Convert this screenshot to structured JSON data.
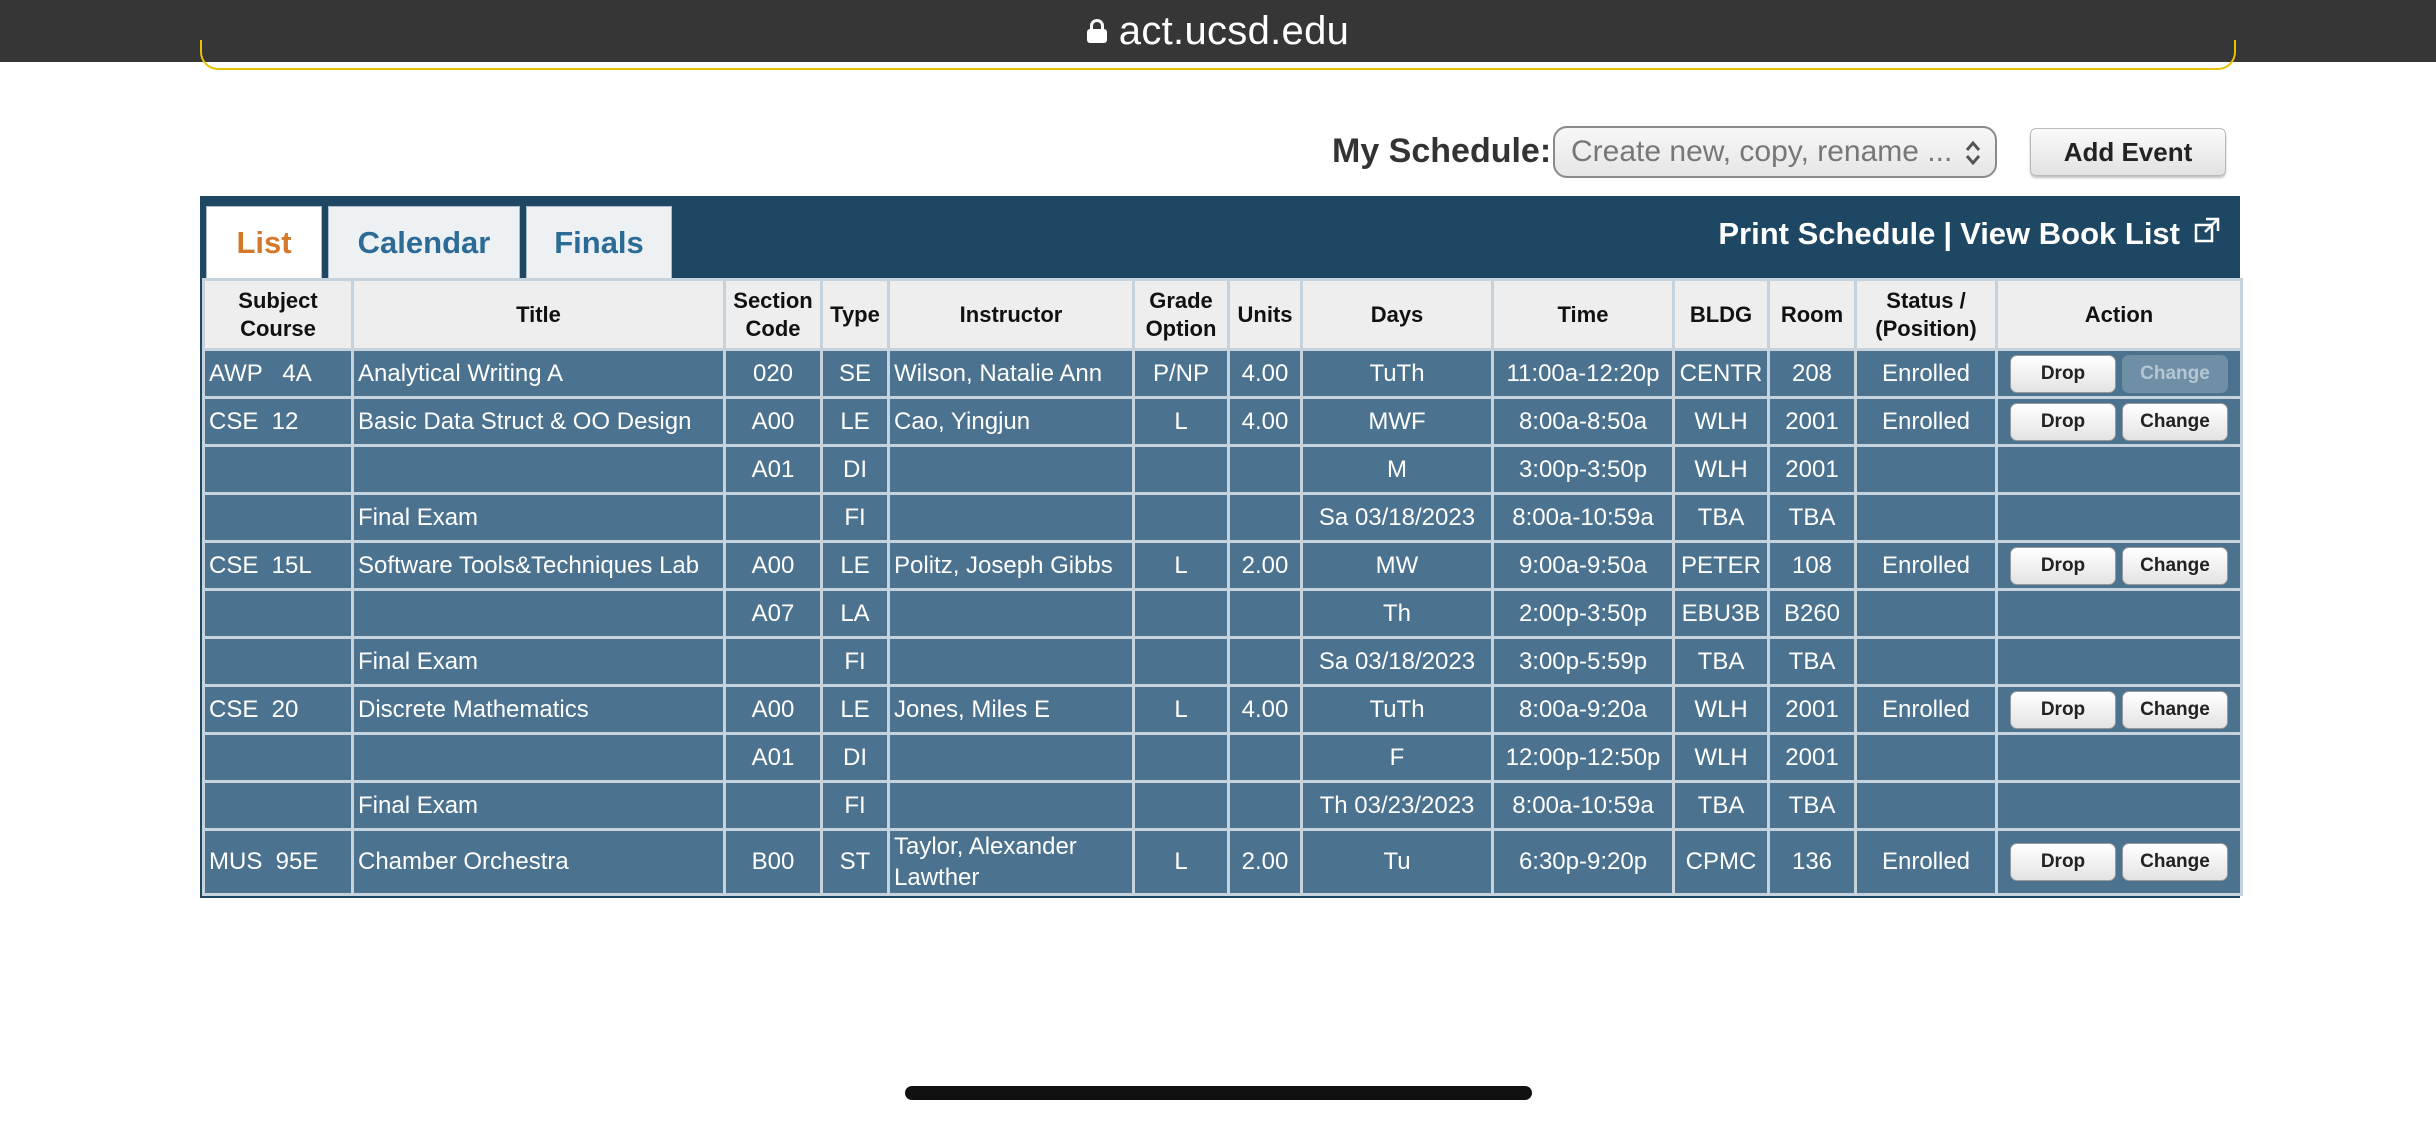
{
  "browser": {
    "url": "act.ucsd.edu"
  },
  "schedule": {
    "label": "My Schedule:",
    "select_placeholder": "Create new, copy, rename ...",
    "add_event_label": "Add Event"
  },
  "tabs": [
    {
      "label": "List",
      "active": true
    },
    {
      "label": "Calendar",
      "active": false
    },
    {
      "label": "Finals",
      "active": false
    }
  ],
  "links": {
    "print": "Print Schedule",
    "separator": "|",
    "booklist": "View Book List"
  },
  "table": {
    "headers": {
      "subject_line1": "Subject",
      "subject_line2": "Course",
      "title": "Title",
      "section_line1": "Section",
      "section_line2": "Code",
      "type": "Type",
      "instructor": "Instructor",
      "grade_line1": "Grade",
      "grade_line2": "Option",
      "units": "Units",
      "days": "Days",
      "time": "Time",
      "bldg": "BLDG",
      "room": "Room",
      "status_line1": "Status /",
      "status_line2": "(Position)",
      "action": "Action"
    },
    "rows": [
      {
        "subject": "AWP   4A",
        "title": "Analytical Writing A",
        "section": "020",
        "type": "SE",
        "instructor": "Wilson, Natalie Ann",
        "grade": "P/NP",
        "units": "4.00",
        "days": "TuTh",
        "time": "11:00a-12:20p",
        "bldg": "CENTR",
        "room": "208",
        "status": "Enrolled",
        "drop": "Drop",
        "change": "Change"
      },
      {
        "subject": "CSE  12",
        "title": "Basic Data Struct & OO Design",
        "section": "A00",
        "type": "LE",
        "instructor": "Cao, Yingjun",
        "grade": "L",
        "units": "4.00",
        "days": "MWF",
        "time": "8:00a-8:50a",
        "bldg": "WLH",
        "room": "2001",
        "status": "Enrolled",
        "drop": "Drop",
        "change": "Change"
      },
      {
        "subject": "",
        "title": "",
        "section": "A01",
        "type": "DI",
        "instructor": "",
        "grade": "",
        "units": "",
        "days": "M",
        "time": "3:00p-3:50p",
        "bldg": "WLH",
        "room": "2001",
        "status": ""
      },
      {
        "subject": "",
        "title": "Final Exam",
        "section": "",
        "type": "FI",
        "instructor": "",
        "grade": "",
        "units": "",
        "days": "Sa 03/18/2023",
        "time": "8:00a-10:59a",
        "bldg": "TBA",
        "room": "TBA",
        "status": ""
      },
      {
        "subject": "CSE  15L",
        "title": "Software Tools&Techniques Lab",
        "section": "A00",
        "type": "LE",
        "instructor": "Politz, Joseph Gibbs",
        "grade": "L",
        "units": "2.00",
        "days": "MW",
        "time": "9:00a-9:50a",
        "bldg": "PETER",
        "room": "108",
        "status": "Enrolled",
        "drop": "Drop",
        "change": "Change"
      },
      {
        "subject": "",
        "title": "",
        "section": "A07",
        "type": "LA",
        "instructor": "",
        "grade": "",
        "units": "",
        "days": "Th",
        "time": "2:00p-3:50p",
        "bldg": "EBU3B",
        "room": "B260",
        "status": ""
      },
      {
        "subject": "",
        "title": "Final Exam",
        "section": "",
        "type": "FI",
        "instructor": "",
        "grade": "",
        "units": "",
        "days": "Sa 03/18/2023",
        "time": "3:00p-5:59p",
        "bldg": "TBA",
        "room": "TBA",
        "status": ""
      },
      {
        "subject": "CSE  20",
        "title": "Discrete Mathematics",
        "section": "A00",
        "type": "LE",
        "instructor": "Jones, Miles E",
        "grade": "L",
        "units": "4.00",
        "days": "TuTh",
        "time": "8:00a-9:20a",
        "bldg": "WLH",
        "room": "2001",
        "status": "Enrolled",
        "drop": "Drop",
        "change": "Change"
      },
      {
        "subject": "",
        "title": "",
        "section": "A01",
        "type": "DI",
        "instructor": "",
        "grade": "",
        "units": "",
        "days": "F",
        "time": "12:00p-12:50p",
        "bldg": "WLH",
        "room": "2001",
        "status": ""
      },
      {
        "subject": "",
        "title": "Final Exam",
        "section": "",
        "type": "FI",
        "instructor": "",
        "grade": "",
        "units": "",
        "days": "Th 03/23/2023",
        "time": "8:00a-10:59a",
        "bldg": "TBA",
        "room": "TBA",
        "status": ""
      },
      {
        "subject": "MUS  95E",
        "title": "Chamber Orchestra",
        "section": "B00",
        "type": "ST",
        "instructor": "Taylor, Alexander Lawther",
        "grade": "L",
        "units": "2.00",
        "days": "Tu",
        "time": "6:30p-9:20p",
        "bldg": "CPMC",
        "room": "136",
        "status": "Enrolled",
        "drop": "Drop",
        "change": "Change"
      }
    ]
  }
}
